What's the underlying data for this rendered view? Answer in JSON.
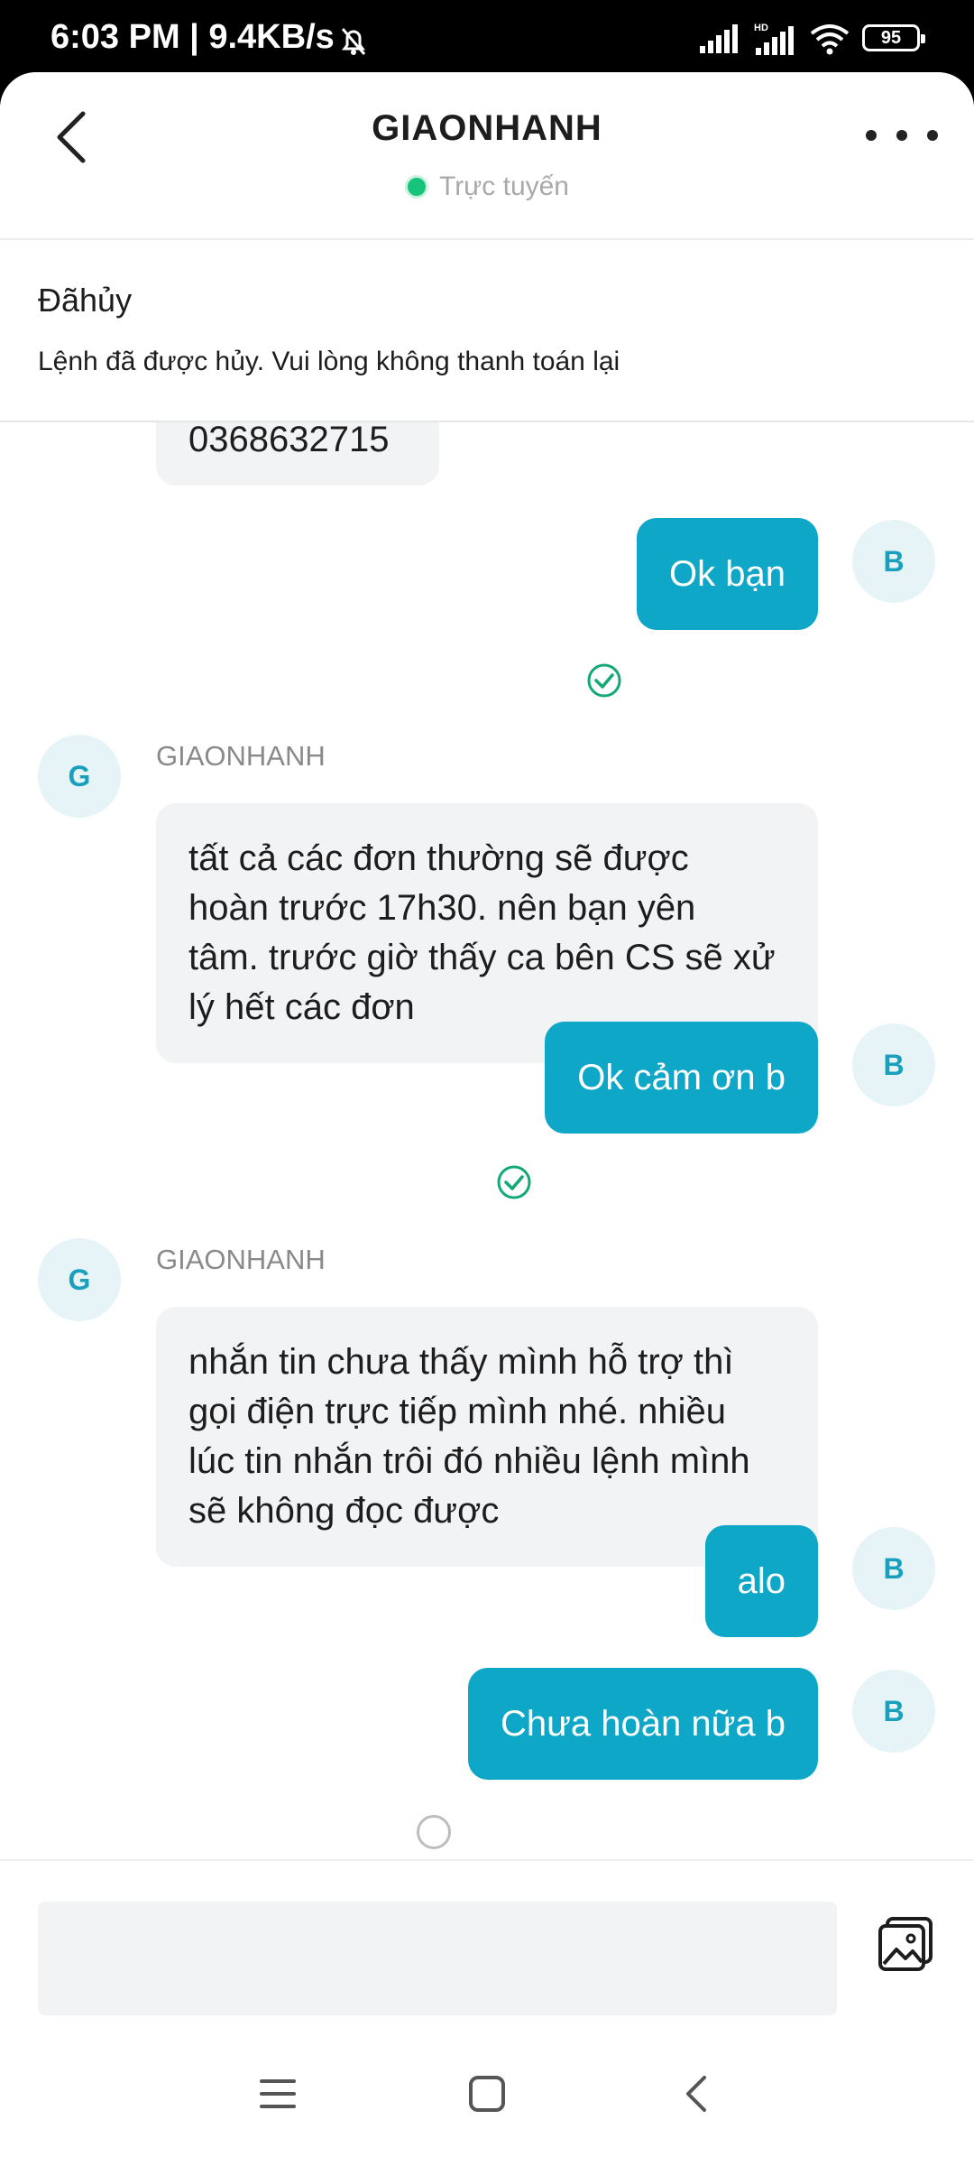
{
  "status_bar": {
    "time_text": "6:03 PM | 9.4KB/s",
    "battery": "95"
  },
  "header": {
    "title": "GIAONHANH",
    "online_text": "Trực tuyến"
  },
  "order": {
    "status": "Đãhủy",
    "note": "Lệnh đã được hủy. Vui lòng không thanh toán lại"
  },
  "chat": {
    "partial_message": "0368632715",
    "messages": [
      {
        "side": "out",
        "avatar": "B",
        "text": "Ok bạn",
        "status": "sent"
      },
      {
        "side": "in",
        "avatar": "G",
        "sender": "GIAONHANH",
        "lines": [
          "tất cả các đơn thường sẽ được",
          "hoàn trước 17h30. nên bạn yên",
          "tâm. trước giờ thấy ca bên CS sẽ xử",
          "lý hết các đơn"
        ]
      },
      {
        "side": "out",
        "avatar": "B",
        "text": "Ok cảm ơn b",
        "status": "sent"
      },
      {
        "side": "in",
        "avatar": "G",
        "sender": "GIAONHANH",
        "lines": [
          "nhắn tin chưa thấy mình hỗ trợ thì",
          "gọi điện trực tiếp mình nhé. nhiều",
          "lúc tin nhắn trôi đó nhiều lệnh mình",
          "sẽ không đọc được"
        ]
      },
      {
        "side": "out",
        "avatar": "B",
        "text": "alo",
        "status": "pending"
      },
      {
        "side": "out",
        "avatar": "B",
        "text": "Chưa hoàn nữa b",
        "status": "pending"
      }
    ]
  },
  "input": {
    "placeholder": "",
    "value": ""
  },
  "colors": {
    "accent": "#0fa7c7",
    "online": "#17c27a",
    "bubble_in": "#f2f3f5"
  }
}
